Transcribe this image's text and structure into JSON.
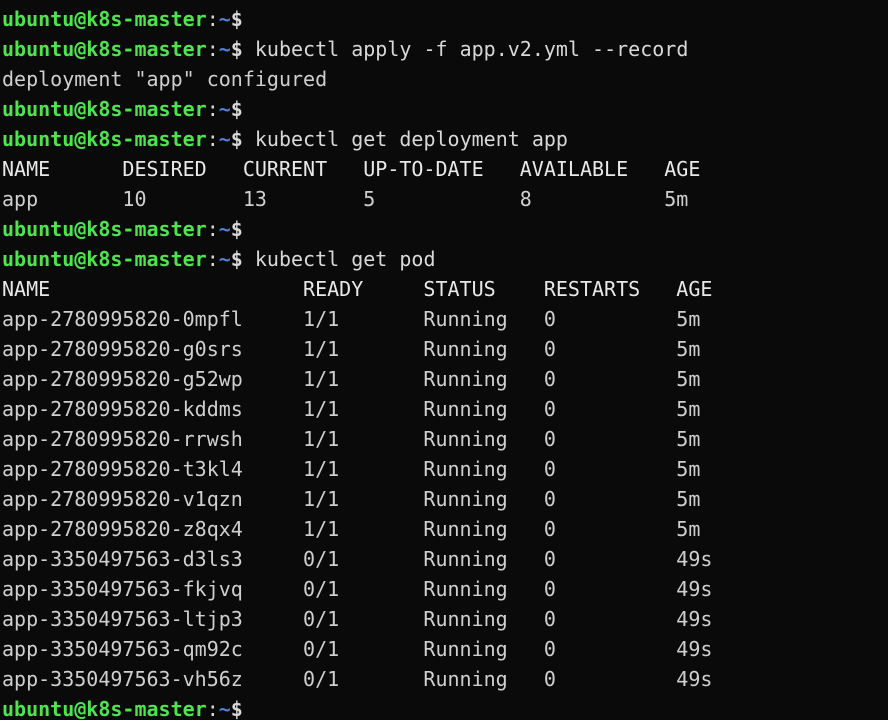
{
  "terminal": {
    "title": "ubuntu@k8s-master terminal",
    "background_color": "#0a0a0a",
    "colors": {
      "prompt_user_host": "#4ee44e",
      "prompt_path_tilde": "#4a7fd4",
      "prompt_symbol": "#d8d8d8",
      "command_text": "#d8d8d8",
      "output_text": "#cfcfcf",
      "header_text": "#e8e8e8"
    },
    "prompt": {
      "user_host": "ubuntu@k8s-master",
      "colon": ":",
      "path": "~",
      "symbol": "$"
    },
    "lines": [
      {
        "type": "prompt",
        "command": ""
      },
      {
        "type": "prompt",
        "command": " kubectl apply -f app.v2.yml --record"
      },
      {
        "type": "output",
        "text": "deployment \"app\" configured"
      },
      {
        "type": "prompt",
        "command": ""
      },
      {
        "type": "prompt",
        "command": " kubectl get deployment app"
      },
      {
        "type": "header",
        "text": "NAME      DESIRED   CURRENT   UP-TO-DATE   AVAILABLE   AGE"
      },
      {
        "type": "output",
        "text": "app       10        13        5            8           5m"
      },
      {
        "type": "prompt",
        "command": ""
      },
      {
        "type": "prompt",
        "command": " kubectl get pod"
      },
      {
        "type": "header",
        "text": "NAME                     READY     STATUS    RESTARTS   AGE"
      },
      {
        "type": "output",
        "text": "app-2780995820-0mpfl     1/1       Running   0          5m"
      },
      {
        "type": "output",
        "text": "app-2780995820-g0srs     1/1       Running   0          5m"
      },
      {
        "type": "output",
        "text": "app-2780995820-g52wp     1/1       Running   0          5m"
      },
      {
        "type": "output",
        "text": "app-2780995820-kddms     1/1       Running   0          5m"
      },
      {
        "type": "output",
        "text": "app-2780995820-rrwsh     1/1       Running   0          5m"
      },
      {
        "type": "output",
        "text": "app-2780995820-t3kl4     1/1       Running   0          5m"
      },
      {
        "type": "output",
        "text": "app-2780995820-v1qzn     1/1       Running   0          5m"
      },
      {
        "type": "output",
        "text": "app-2780995820-z8qx4     1/1       Running   0          5m"
      },
      {
        "type": "output",
        "text": "app-3350497563-d3ls3     0/1       Running   0          49s"
      },
      {
        "type": "output",
        "text": "app-3350497563-fkjvq     0/1       Running   0          49s"
      },
      {
        "type": "output",
        "text": "app-3350497563-ltjp3     0/1       Running   0          49s"
      },
      {
        "type": "output",
        "text": "app-3350497563-qm92c     0/1       Running   0          49s"
      },
      {
        "type": "output",
        "text": "app-3350497563-vh56z     0/1       Running   0          49s"
      },
      {
        "type": "prompt",
        "command": ""
      }
    ],
    "commands_issued": [
      "kubectl apply -f app.v2.yml --record",
      "kubectl get deployment app",
      "kubectl get pod"
    ],
    "deployment_table": {
      "columns": [
        "NAME",
        "DESIRED",
        "CURRENT",
        "UP-TO-DATE",
        "AVAILABLE",
        "AGE"
      ],
      "rows": [
        {
          "NAME": "app",
          "DESIRED": "10",
          "CURRENT": "13",
          "UP-TO-DATE": "5",
          "AVAILABLE": "8",
          "AGE": "5m"
        }
      ]
    },
    "pod_table": {
      "columns": [
        "NAME",
        "READY",
        "STATUS",
        "RESTARTS",
        "AGE"
      ],
      "rows": [
        {
          "NAME": "app-2780995820-0mpfl",
          "READY": "1/1",
          "STATUS": "Running",
          "RESTARTS": "0",
          "AGE": "5m"
        },
        {
          "NAME": "app-2780995820-g0srs",
          "READY": "1/1",
          "STATUS": "Running",
          "RESTARTS": "0",
          "AGE": "5m"
        },
        {
          "NAME": "app-2780995820-g52wp",
          "READY": "1/1",
          "STATUS": "Running",
          "RESTARTS": "0",
          "AGE": "5m"
        },
        {
          "NAME": "app-2780995820-kddms",
          "READY": "1/1",
          "STATUS": "Running",
          "RESTARTS": "0",
          "AGE": "5m"
        },
        {
          "NAME": "app-2780995820-rrwsh",
          "READY": "1/1",
          "STATUS": "Running",
          "RESTARTS": "0",
          "AGE": "5m"
        },
        {
          "NAME": "app-2780995820-t3kl4",
          "READY": "1/1",
          "STATUS": "Running",
          "RESTARTS": "0",
          "AGE": "5m"
        },
        {
          "NAME": "app-2780995820-v1qzn",
          "READY": "1/1",
          "STATUS": "Running",
          "RESTARTS": "0",
          "AGE": "5m"
        },
        {
          "NAME": "app-2780995820-z8qx4",
          "READY": "1/1",
          "STATUS": "Running",
          "RESTARTS": "0",
          "AGE": "5m"
        },
        {
          "NAME": "app-3350497563-d3ls3",
          "READY": "0/1",
          "STATUS": "Running",
          "RESTARTS": "0",
          "AGE": "49s"
        },
        {
          "NAME": "app-3350497563-fkjvq",
          "READY": "0/1",
          "STATUS": "Running",
          "RESTARTS": "0",
          "AGE": "49s"
        },
        {
          "NAME": "app-3350497563-ltjp3",
          "READY": "0/1",
          "STATUS": "Running",
          "RESTARTS": "0",
          "AGE": "49s"
        },
        {
          "NAME": "app-3350497563-qm92c",
          "READY": "0/1",
          "STATUS": "Running",
          "RESTARTS": "0",
          "AGE": "49s"
        },
        {
          "NAME": "app-3350497563-vh56z",
          "READY": "0/1",
          "STATUS": "Running",
          "RESTARTS": "0",
          "AGE": "49s"
        }
      ]
    }
  }
}
